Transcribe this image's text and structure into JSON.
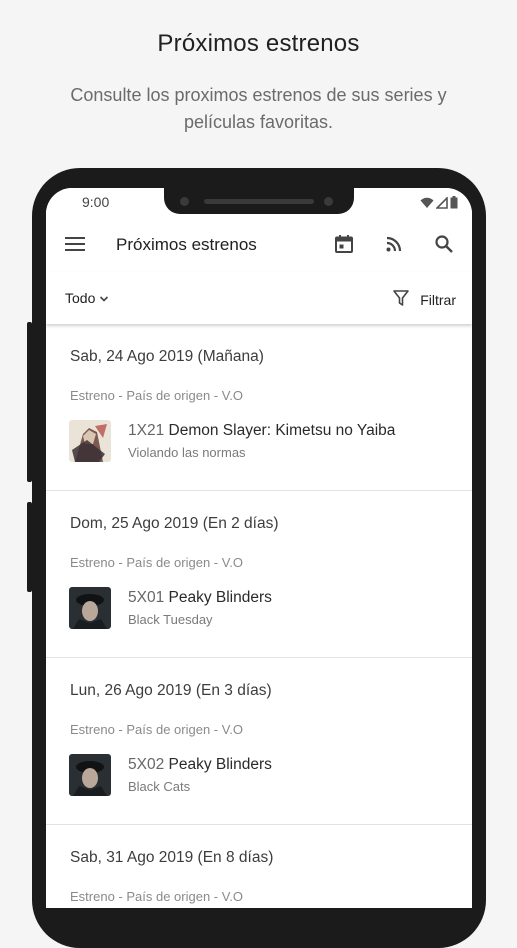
{
  "promo": {
    "title": "Próximos estrenos",
    "subtitle": "Consulte los proximos estrenos de sus series y películas favoritas."
  },
  "status_bar": {
    "time": "9:00"
  },
  "toolbar": {
    "title": "Próximos estrenos",
    "icons": [
      "menu-icon",
      "calendar-icon",
      "cast-icon",
      "search-icon"
    ]
  },
  "filter_bar": {
    "scope_label": "Todo",
    "filter_label": "Filtrar"
  },
  "days": [
    {
      "date": "Sab, 24 Ago 2019 (Mañana)",
      "meta": "Estreno - País de origen - V.O",
      "episode": {
        "code": "1X21",
        "show": "Demon Slayer: Kimetsu no Yaiba",
        "subtitle": "Violando las normas"
      }
    },
    {
      "date": "Dom, 25 Ago 2019 (En 2 días)",
      "meta": "Estreno - País de origen - V.O",
      "episode": {
        "code": "5X01",
        "show": "Peaky Blinders",
        "subtitle": "Black Tuesday"
      }
    },
    {
      "date": "Lun, 26 Ago 2019 (En 3 días)",
      "meta": "Estreno - País de origen - V.O",
      "episode": {
        "code": "5X02",
        "show": "Peaky Blinders",
        "subtitle": "Black Cats"
      }
    },
    {
      "date": "Sab, 31 Ago 2019 (En 8 días)",
      "meta": "Estreno - País de origen - V.O",
      "episode": {
        "code": "",
        "show": "",
        "subtitle": ""
      }
    }
  ],
  "colors": {
    "background": "#f5f5f5",
    "device": "#1b1b1b",
    "surface": "#ffffff",
    "text": "#212121"
  }
}
